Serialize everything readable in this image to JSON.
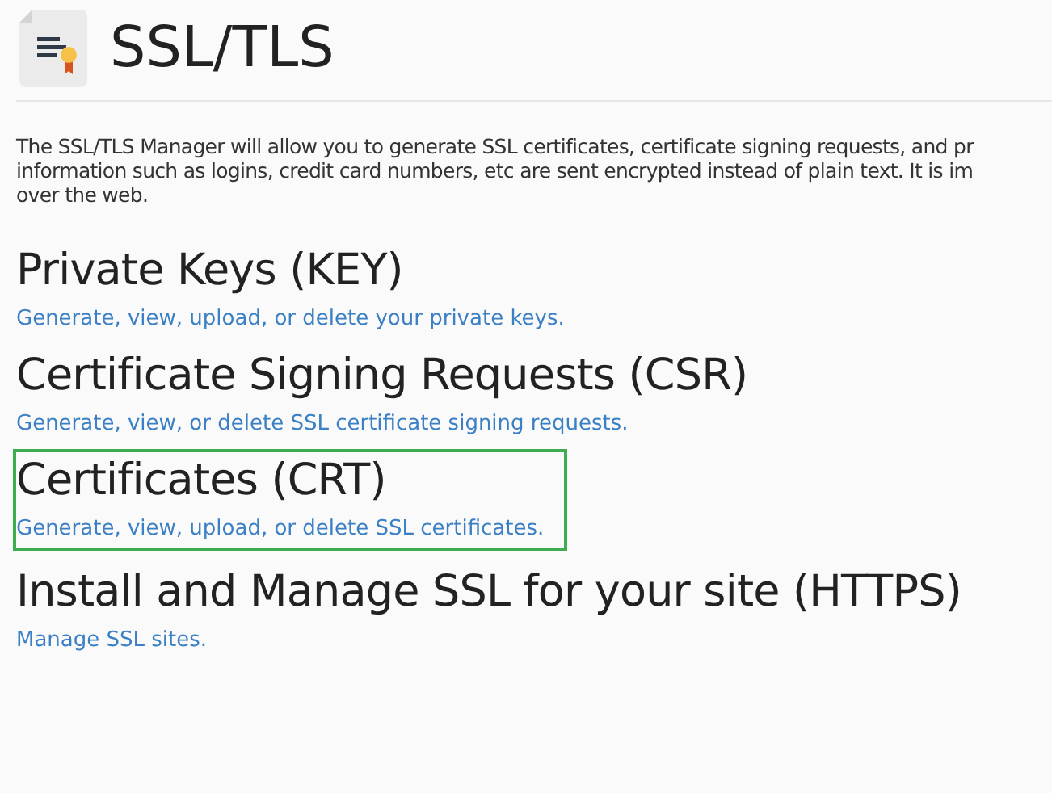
{
  "page_title": "SSL/TLS",
  "intro_lines": [
    "The SSL/TLS Manager will allow you to generate SSL certificates, certificate signing requests, and pr",
    "information such as logins, credit card numbers, etc are sent encrypted instead of plain text. It is im",
    "over the web."
  ],
  "sections": [
    {
      "heading": "Private Keys (KEY)",
      "link": "Generate, view, upload, or delete your private keys.",
      "highlighted": false
    },
    {
      "heading": "Certificate Signing Requests (CSR)",
      "link": "Generate, view, or delete SSL certificate signing requests.",
      "highlighted": false
    },
    {
      "heading": "Certificates (CRT)",
      "link": "Generate, view, upload, or delete SSL certificates.",
      "highlighted": true
    },
    {
      "heading": "Install and Manage SSL for your site (HTTPS)",
      "link": "Manage SSL sites.",
      "highlighted": false
    }
  ]
}
